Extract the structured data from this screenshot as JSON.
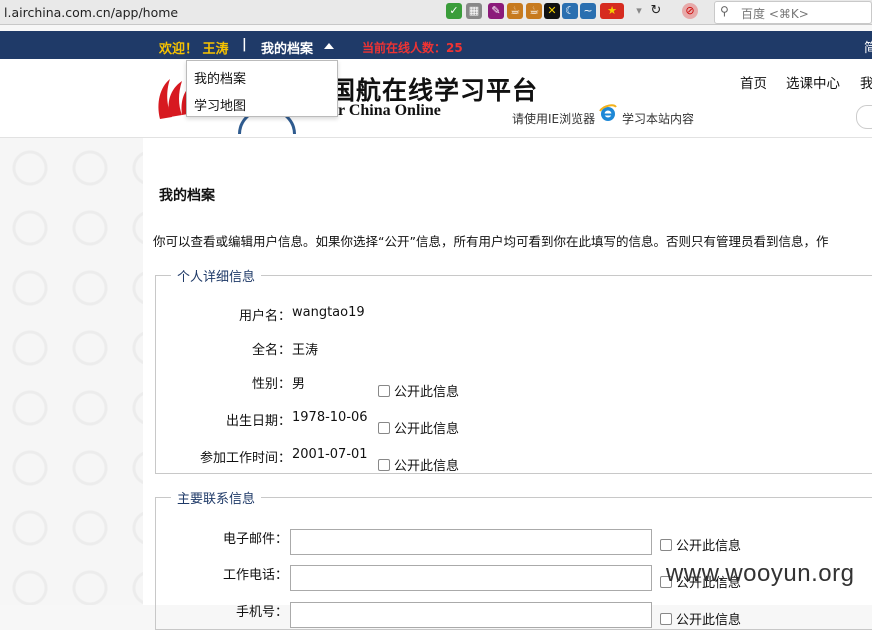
{
  "browser": {
    "url": "l.airchina.com.cn/app/home",
    "search_placeholder": "百度 <⌘K>"
  },
  "topbar": {
    "welcome": "欢迎！ 王涛",
    "separator": "|",
    "archive_menu": "我的档案",
    "online_count": "当前在线人数：25",
    "right_text": "简"
  },
  "dropdown": {
    "items": [
      "我的档案",
      "学习地图"
    ]
  },
  "header": {
    "brand_cn": "国航在线学习平台",
    "brand_en": "Air China Online",
    "ie_note_before": "请使用IE浏览器",
    "ie_note_after": "学习本站内容",
    "nav": [
      "首页",
      "选课中心",
      "我"
    ]
  },
  "main": {
    "title": "我的档案",
    "intro": "你可以查看或编辑用户信息。如果你选择“公开”信息，所有用户均可看到你在此填写的信息。否则只有管理员看到信息，作"
  },
  "personal": {
    "legend": "个人详细信息",
    "public_label": "公开此信息",
    "fields": [
      {
        "label": "用户名：",
        "value": "wangtao19"
      },
      {
        "label": "全名：",
        "value": "王涛"
      },
      {
        "label": "性别：",
        "value": "男"
      },
      {
        "label": "出生日期：",
        "value": "1978-10-06"
      },
      {
        "label": "参加工作时间：",
        "value": "2001-07-01"
      }
    ]
  },
  "contact": {
    "legend": "主要联系信息",
    "public_label": "公开此信息",
    "fields": [
      {
        "label": "电子邮件：",
        "value": ""
      },
      {
        "label": "工作电话：",
        "value": ""
      },
      {
        "label": "手机号：",
        "value": ""
      }
    ]
  },
  "watermark": "www.wooyun.org",
  "colors": {
    "topbar_bg": "#1f3a68",
    "welcome": "#f6c200",
    "online": "#e33333",
    "legend": "#1f3a68"
  }
}
